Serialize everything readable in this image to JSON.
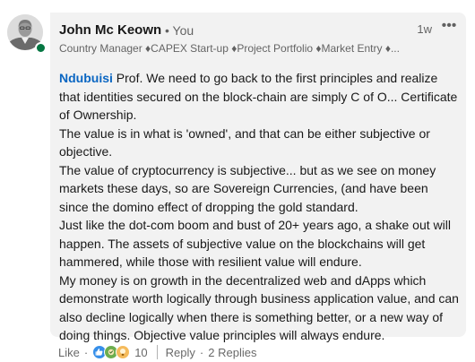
{
  "author": {
    "name": "John Mc Keown",
    "degree": "• You",
    "headline": "Country Manager ♦CAPEX Start-up ♦Project Portfolio ♦Market Entry ♦...",
    "timestamp": "1w",
    "more_label": "•••"
  },
  "comment": {
    "mention": "Ndubuisi",
    "paragraphs": [
      " Prof. We need to go back to the first principles and realize that identities secured on the block-chain are simply C of O... Certificate of Ownership.",
      "The value is in what is 'owned', and that can be either subjective or objective.",
      "The value of cryptocurrency is subjective... but as we see on money markets these days, so are Sovereign Currencies, (and have been since the domino effect of dropping the gold standard.",
      "Just like the dot-com boom and bust of 20+ years ago, a shake out will happen. The assets of subjective value on the blockchains will get hammered, while those with resilient value will endure.",
      "My money is on growth in the decentralized web and dApps which demonstrate worth logically through business application value, and can also decline logically when there is something better, or a new way of doing things. Objective value principles will always endure."
    ]
  },
  "actions": {
    "like_label": "Like",
    "separator": "·",
    "reaction_count": "10",
    "reply_label": "Reply",
    "replies_label": "2 Replies",
    "reaction_icons": [
      "like-icon",
      "celebrate-icon",
      "insightful-icon"
    ]
  },
  "colors": {
    "link": "#0a66c2",
    "bubble": "#f2f2f2",
    "online": "#057642",
    "like": "#378fe9",
    "celebrate": "#6dae4f",
    "insightful": "#f5bb5c"
  }
}
